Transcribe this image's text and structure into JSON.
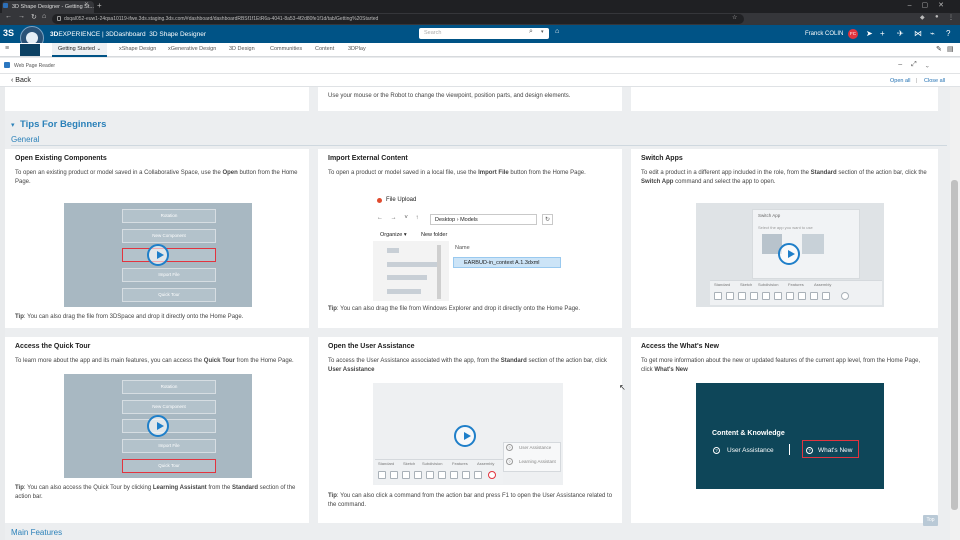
{
  "browser": {
    "tab_title": "3D Shape Designer - Getting St...",
    "url": "dsqal052-euw1-24qsa10119-ifwe.3ds.staging.3ds.com/#dashboard/dashboardRBSf1f1EtR6a-4041-8a53-4f2d80fe1f1d/tab/Getting%20Started"
  },
  "appbar": {
    "brand_prefix": "3D",
    "brand_rest": "EXPERIENCE | 3DDashboard",
    "app_name": "3D Shape Designer",
    "search_placeholder": "Search",
    "user_name": "Franck COLIN",
    "user_initials": "FC"
  },
  "dashboard_tabs": [
    "Getting Started",
    "xShape Design",
    "xGenerative Design",
    "3D Design",
    "Communities",
    "Content",
    "3DPlay"
  ],
  "widget": {
    "title": "Web Page Reader",
    "back_label": "Back",
    "open_all": "Open all",
    "close_all": "Close all",
    "separator": "|"
  },
  "prev_text": {
    "middle": "Use your mouse or the Robot to change the viewpoint, position parts, and design elements."
  },
  "section": {
    "title": "Tips For Beginners",
    "subsection": "General",
    "next_section": "Main Features",
    "top_button": "Top"
  },
  "cards": [
    {
      "title": "Open Existing Components",
      "desc_parts": [
        "To open an existing product or model saved in a Collaborative Space, use the ",
        "Open",
        " button from the Home Page."
      ],
      "tip": "You can also drag the file from 3DSpace and drop it directly onto the Home Page.",
      "menu": [
        "Rotation",
        "New Component",
        "",
        "Import File",
        "Quick Tour"
      ]
    },
    {
      "title": "Import External Content",
      "desc_parts": [
        "To open a product or model saved in a local file, use the ",
        "Import File",
        " button from the Home Page."
      ],
      "tip": "You can also drag the file from Windows Explorer and drop it directly onto the Home Page."
    },
    {
      "title": "Switch Apps",
      "desc_html": [
        "To edit a product in a different app included in the role, from the ",
        "Standard",
        " section of the action bar, click the ",
        "Switch App",
        " command and select the app to open."
      ]
    },
    {
      "title": "Access the Quick Tour",
      "desc_parts": [
        "To learn more about the app and its main features, you can access the ",
        "Quick Tour",
        " from the Home Page."
      ],
      "tip_parts": [
        "You can also access the Quick Tour by clicking ",
        "Learning Assistant",
        " from the ",
        "Standard",
        " section of the action bar."
      ],
      "menu": [
        "Rotation",
        "New Component",
        "",
        "Import File",
        "Quick Tour"
      ]
    },
    {
      "title": "Open the User Assistance",
      "desc_parts": [
        "To access the User Assistance associated with the app, from the ",
        "Standard",
        " section of the action bar, click ",
        "User Assistance"
      ],
      "tip": "You can also click a command from the action bar and press F1 to open the User Assistance related to the command."
    },
    {
      "title": "Access the What's New",
      "desc_parts": [
        "To get more information about the new or updated features of the current app level, from the Home Page, click ",
        "What's New"
      ]
    }
  ],
  "tip_label": "Tip",
  "file_dialog": {
    "title": "File Upload",
    "path_1": "Desktop",
    "path_2": "Models",
    "organize": "Organize",
    "new_folder": "New folder",
    "column": "Name",
    "file": "EARBUD-in_context A.1.3dxml"
  },
  "switch_app": {
    "title": "Switch App",
    "prompt": "Select the app you want to use"
  },
  "toolbar_tabs": [
    "Standard",
    "Sketch",
    "Subdivision",
    "Features",
    "Assembly"
  ],
  "user_assistance_menu": [
    "User Assistance",
    "Learning Assistant"
  ],
  "whats_new": {
    "heading": "Content & Knowledge",
    "user_assistance": "User Assistance",
    "whats_new": "What's New"
  }
}
